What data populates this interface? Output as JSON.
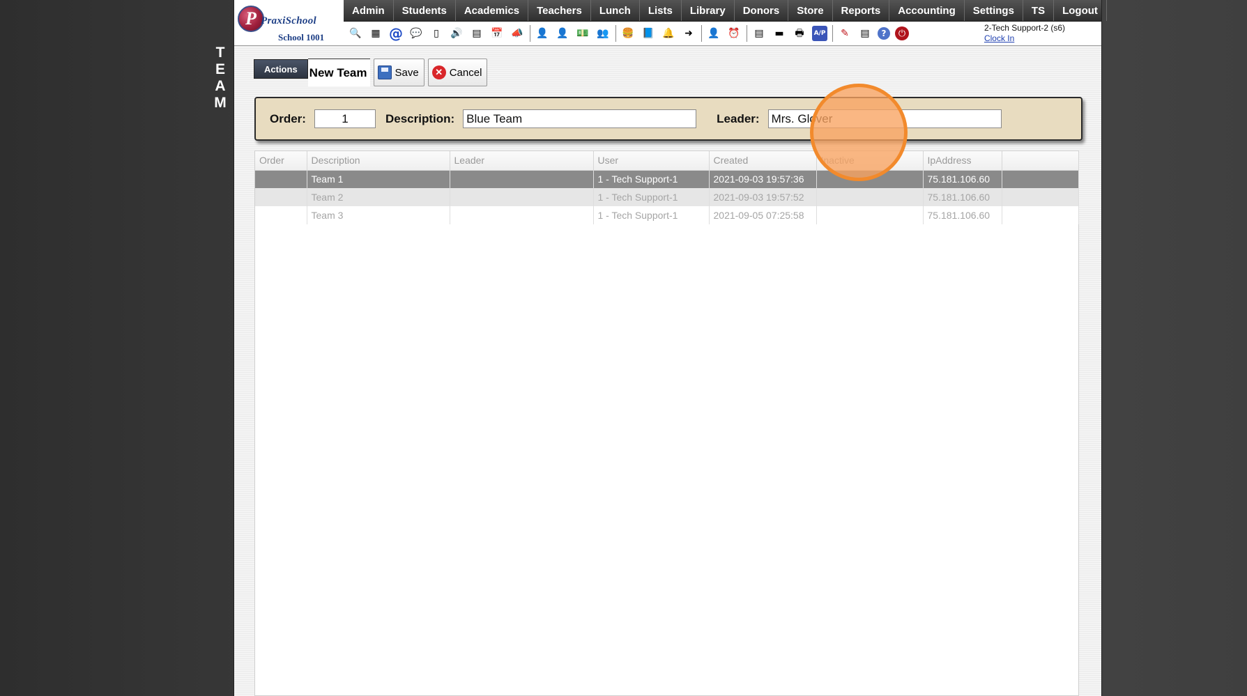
{
  "side_title": [
    "T",
    "E",
    "A",
    "M"
  ],
  "logo": {
    "brand": "PraxiSchool",
    "initial": "P",
    "school": "School 1001"
  },
  "menu": [
    "Admin",
    "Students",
    "Academics",
    "Teachers",
    "Lunch",
    "Lists",
    "Library",
    "Donors",
    "Store",
    "Reports",
    "Accounting",
    "Settings",
    "TS",
    "Logout"
  ],
  "toolbar_icons": [
    {
      "name": "search-icon",
      "glyph": "🔍"
    },
    {
      "name": "grid-icon",
      "glyph": "▦"
    },
    {
      "name": "email-icon",
      "glyph": "@"
    },
    {
      "name": "chat-icon",
      "glyph": "💬"
    },
    {
      "name": "phone-icon",
      "glyph": "▯"
    },
    {
      "name": "speaker-icon",
      "glyph": "🔊"
    },
    {
      "name": "report-icon",
      "glyph": "▤"
    },
    {
      "name": "calendar-icon",
      "glyph": "📅"
    },
    {
      "name": "megaphone-icon",
      "glyph": "📣"
    },
    {
      "sep": true
    },
    {
      "name": "student-add-icon",
      "glyph": "👤"
    },
    {
      "name": "student-icon",
      "glyph": "👤"
    },
    {
      "name": "money-icon",
      "glyph": "💵"
    },
    {
      "name": "family-icon",
      "glyph": "👥"
    },
    {
      "sep": true
    },
    {
      "name": "lunch-icon",
      "glyph": "🍔"
    },
    {
      "name": "book-icon",
      "glyph": "📘"
    },
    {
      "name": "bell-icon",
      "glyph": "🔔"
    },
    {
      "name": "export-icon",
      "glyph": "➜"
    },
    {
      "sep": true
    },
    {
      "name": "staff-icon",
      "glyph": "👤"
    },
    {
      "name": "clock-icon",
      "glyph": "⏰"
    },
    {
      "sep": true
    },
    {
      "name": "document-icon",
      "glyph": "▤"
    },
    {
      "name": "card-icon",
      "glyph": "▬"
    },
    {
      "name": "printer-icon",
      "glyph": "🖶"
    },
    {
      "name": "ap-icon",
      "glyph": "A/P"
    },
    {
      "sep": true
    },
    {
      "name": "pdf-icon",
      "glyph": "✎"
    },
    {
      "name": "cash-icon",
      "glyph": "▤"
    },
    {
      "name": "help-icon",
      "glyph": "?"
    },
    {
      "name": "power-icon",
      "glyph": "⏻"
    }
  ],
  "user": {
    "name": "2-Tech Support-2 (s6)",
    "clock_link": "Clock In"
  },
  "actions": {
    "actions_label": "Actions",
    "form_title": "New Team",
    "save_label": "Save",
    "cancel_label": "Cancel"
  },
  "form": {
    "order_label": "Order:",
    "order_value": "1",
    "description_label": "Description:",
    "description_value": "Blue Team",
    "leader_label": "Leader:",
    "leader_value": "Mrs. Glover"
  },
  "grid": {
    "columns": [
      "Order",
      "Description",
      "Leader",
      "User",
      "Created",
      "Inactive",
      "IpAddress",
      ""
    ],
    "rows": [
      [
        "",
        "Team 1",
        "",
        "1 - Tech Support-1",
        "2021-09-03 19:57:36",
        "",
        "75.181.106.60",
        ""
      ],
      [
        "",
        "Team 2",
        "",
        "1 - Tech Support-1",
        "2021-09-03 19:57:52",
        "",
        "75.181.106.60",
        ""
      ],
      [
        "",
        "Team 3",
        "",
        "1 - Tech Support-1",
        "2021-09-05 07:25:58",
        "",
        "75.181.106.60",
        ""
      ]
    ],
    "selected_row": 0
  },
  "colors": {
    "accent_marker": "#f28a2c",
    "panel_bg": "#e8dcc0",
    "selected_row": "#8a8a8a"
  }
}
